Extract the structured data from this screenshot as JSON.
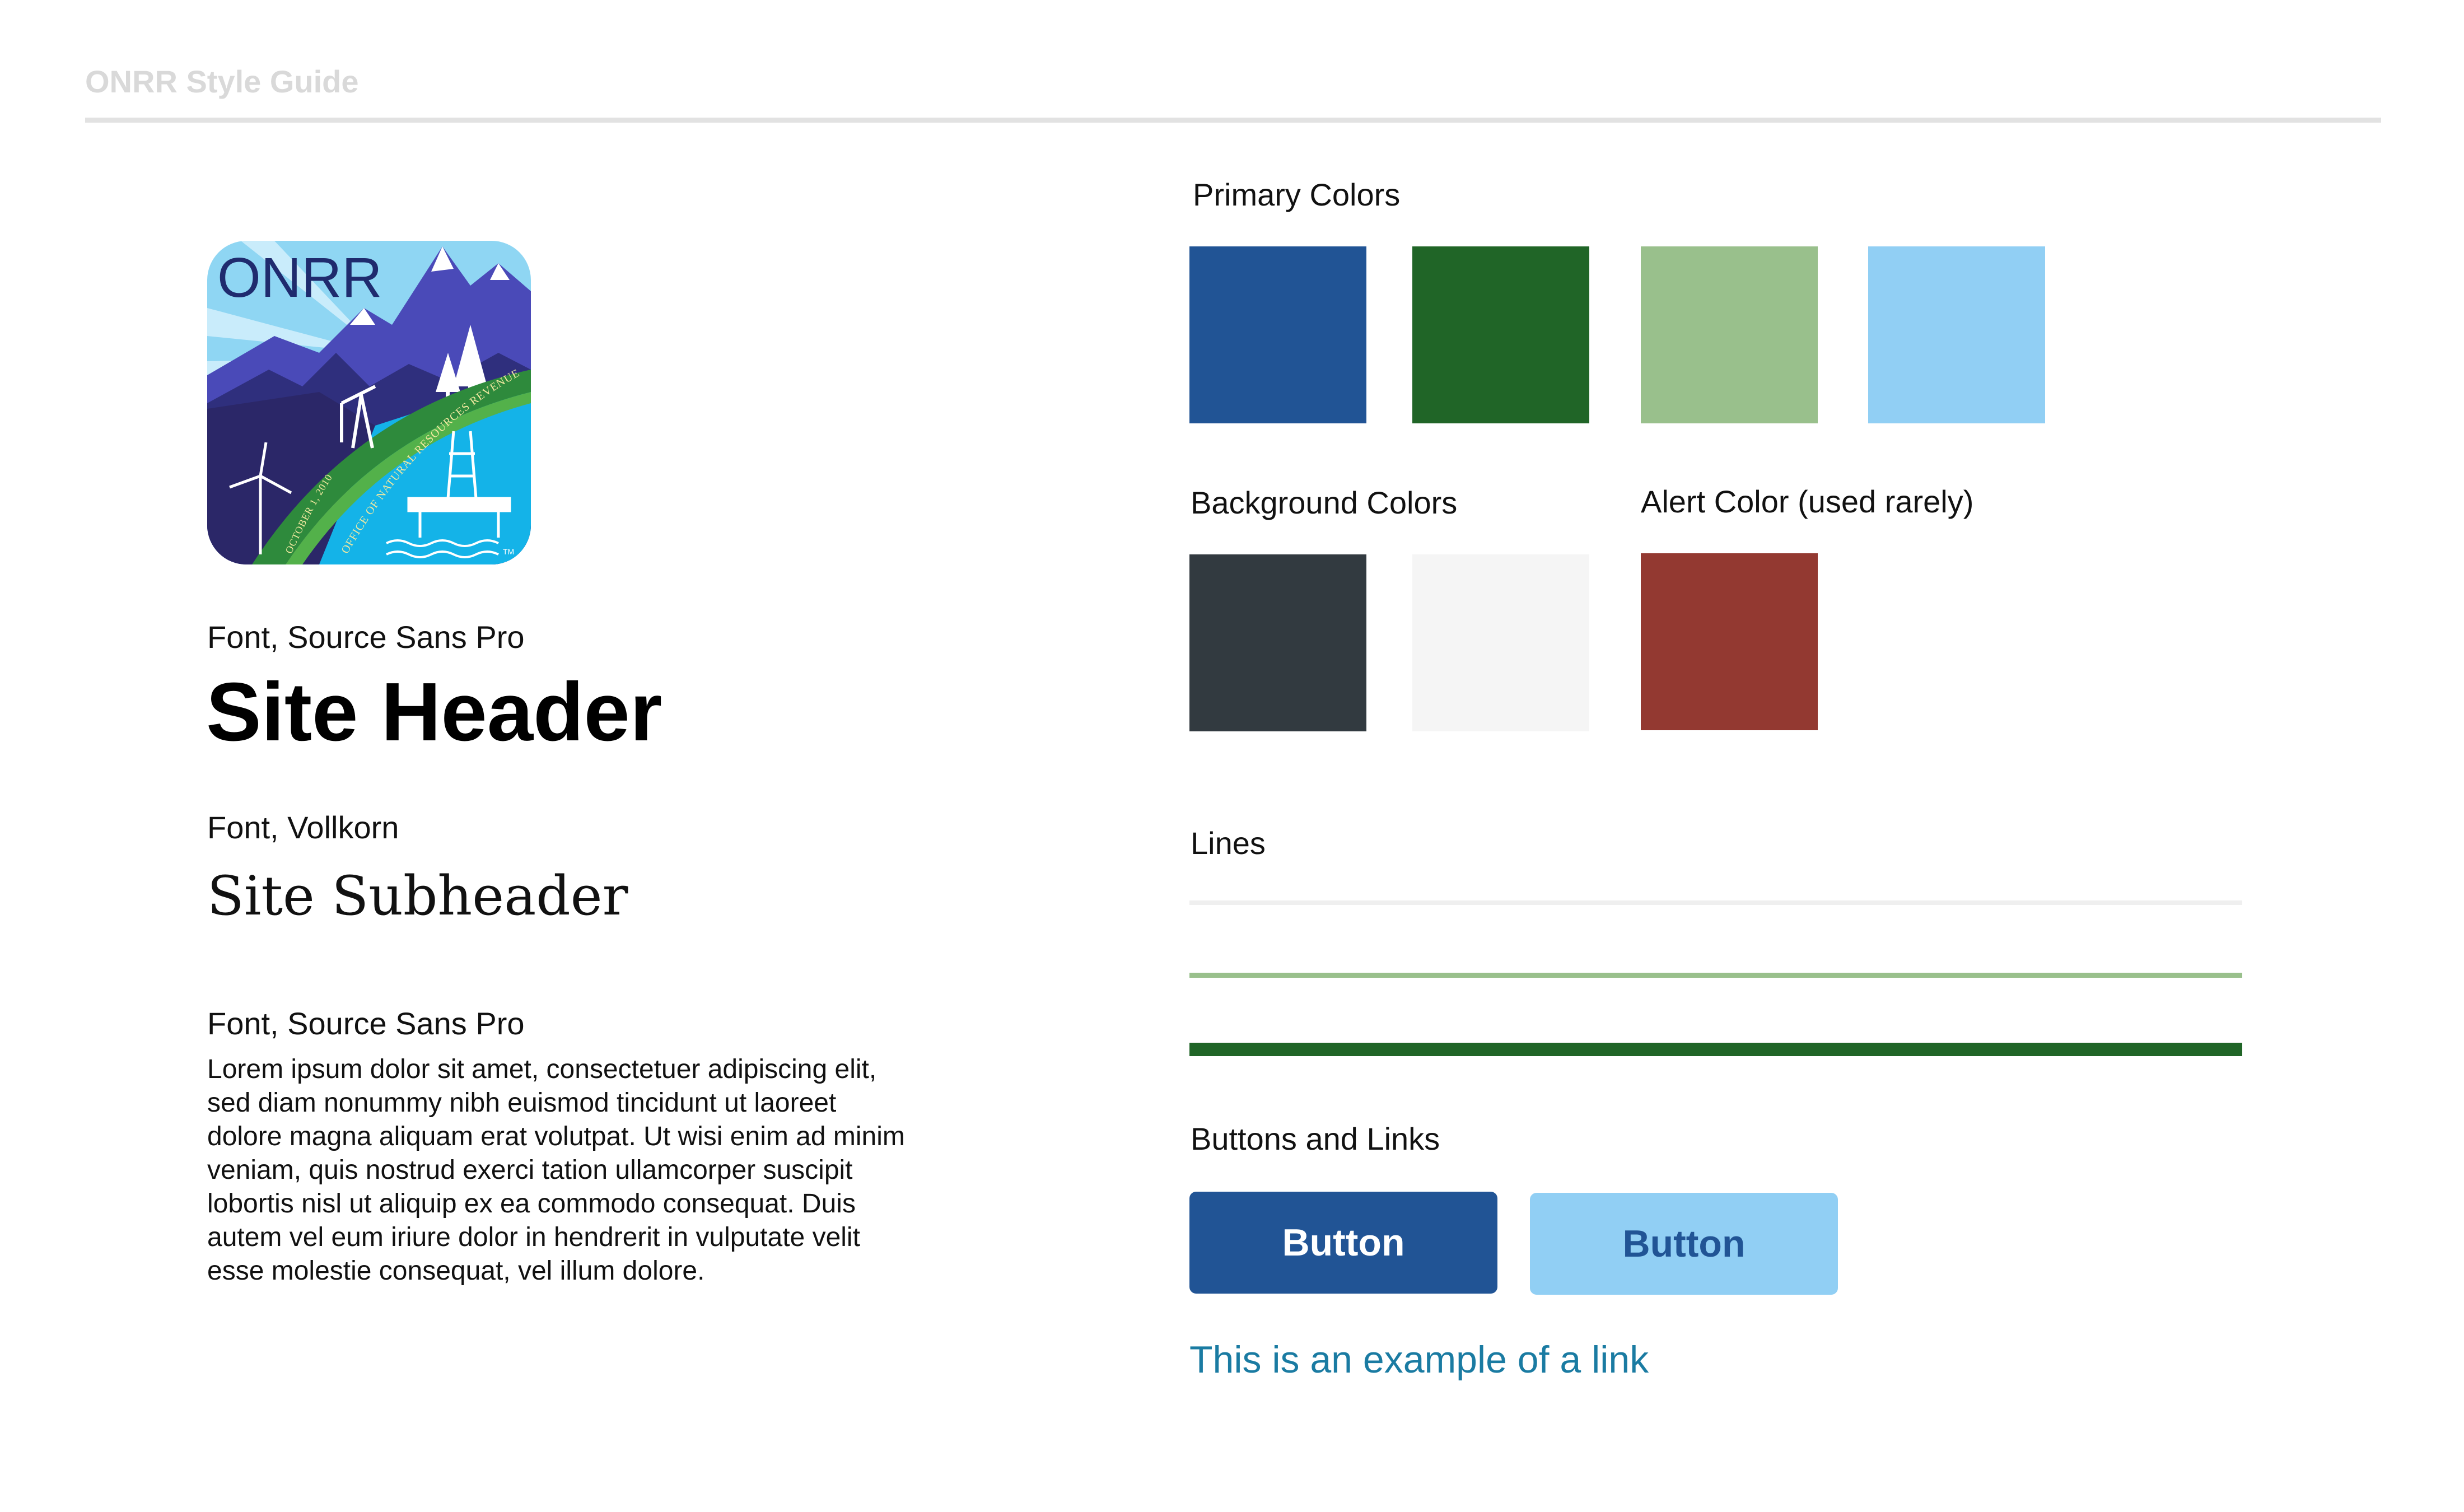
{
  "header": {
    "title": "ONRR Style Guide"
  },
  "logo": {
    "wordmark": "ONRR",
    "ring_text": "OFFICE OF NATURAL RESOURCES REVENUE",
    "date_text": "OCTOBER 1, 2010",
    "trademark": "TM"
  },
  "typography": {
    "header_font_label": "Font, Source Sans Pro",
    "header_sample": "Site Header",
    "subheader_font_label": "Font, Vollkorn",
    "subheader_sample": "Site Subheader",
    "body_font_label": "Font, Source Sans Pro",
    "body_sample": "Lorem ipsum dolor sit amet, consectetuer adipiscing elit, sed diam nonummy nibh euismod tincidunt ut laoreet dolore magna aliquam erat volutpat. Ut wisi enim ad minim veniam, quis nostrud exerci tation ullamcorper suscipit lobortis nisl ut aliquip ex ea commodo consequat. Duis autem vel eum iriure dolor in hendrerit in vulputate velit esse molestie consequat, vel illum dolore."
  },
  "colors": {
    "primary_label": "Primary Colors",
    "primary": [
      "#215495",
      "#206527",
      "#99c08c",
      "#91cff4"
    ],
    "background_label": "Background Colors",
    "background": [
      "#323a40",
      "#f5f5f5"
    ],
    "alert_label": "Alert Color (used rarely)",
    "alert": [
      "#933931"
    ]
  },
  "lines": {
    "label": "Lines",
    "items": [
      {
        "color": "#efefef"
      },
      {
        "color": "#99c08c"
      },
      {
        "color": "#206527"
      }
    ]
  },
  "buttons": {
    "label": "Buttons and Links",
    "primary_label": "Button",
    "primary_bg": "#215495",
    "primary_fg": "#ffffff",
    "secondary_label": "Button",
    "secondary_bg": "#91cff4",
    "secondary_fg": "#215495",
    "link_text": "This is an example of a link",
    "link_color": "#1a7ba2"
  }
}
